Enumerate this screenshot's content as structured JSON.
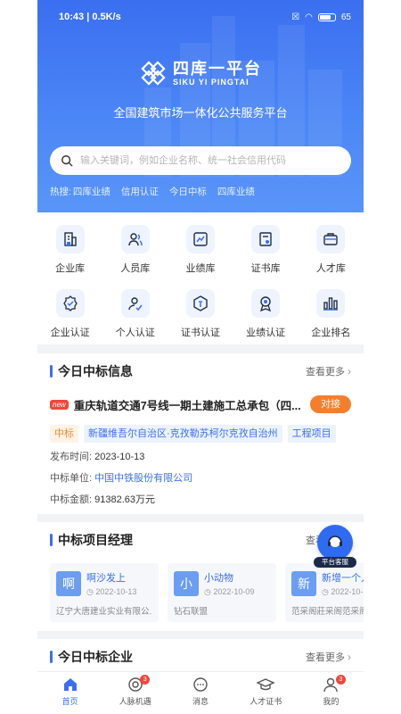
{
  "status": {
    "time_speed": "10:43 | 0.5K/s",
    "battery": "65"
  },
  "brand": {
    "name_cn": "四库一平台",
    "name_en": "SIKU YI PINGTAI",
    "slogan": "全国建筑市场一体化公共服务平台"
  },
  "search": {
    "placeholder": "输入关键词，例如企业名称、统一社会信用代码",
    "hot_label": "热搜:",
    "hot_items": [
      "四库业绩",
      "信用认证",
      "今日中标",
      "四库业绩"
    ]
  },
  "grid": [
    {
      "label": "企业库",
      "icon": "building-icon"
    },
    {
      "label": "人员库",
      "icon": "people-icon"
    },
    {
      "label": "业绩库",
      "icon": "chart-icon"
    },
    {
      "label": "证书库",
      "icon": "certificate-icon"
    },
    {
      "label": "人才库",
      "icon": "briefcase-icon"
    },
    {
      "label": "企业认证",
      "icon": "badge-check-icon"
    },
    {
      "label": "个人认证",
      "icon": "user-check-icon"
    },
    {
      "label": "证书认证",
      "icon": "box-icon"
    },
    {
      "label": "业绩认证",
      "icon": "medal-icon"
    },
    {
      "label": "企业排名",
      "icon": "bars-icon"
    }
  ],
  "bids": {
    "title": "今日中标信息",
    "more": "查看更多",
    "new_tag": "new",
    "item_title": "重庆轨道交通7号线一期土建施工总承包（四...",
    "dock_label": "对接",
    "tags": [
      "中标",
      "新疆维吾尔自治区·克孜勒苏柯尔克孜自治州",
      "工程项目"
    ],
    "publish_label": "发布时间:",
    "publish_date": "2023-10-13",
    "unit_label": "中标单位:",
    "unit_value": "中国中铁股份有限公司",
    "amount_label": "中标金额:",
    "amount_value": "91382.63万元"
  },
  "managers": {
    "title": "中标项目经理",
    "more": "查看更多",
    "items": [
      {
        "avatar": "啊",
        "name": "啊沙发上",
        "date": "2022-10-13",
        "company": "辽宁大唐建业实业有限公...",
        "color": "#6b9df2"
      },
      {
        "avatar": "小",
        "name": "小动物",
        "date": "2022-10-09",
        "company": "钻石联盟",
        "color": "#6b9df2"
      },
      {
        "avatar": "新",
        "name": "新增一个人",
        "date": "2022-10-",
        "company": "范采阁莊采阁范采阁",
        "color": "#6b9df2"
      }
    ]
  },
  "float_service": "平台客服",
  "companies": {
    "title": "今日中标企业",
    "more": "查看更多"
  },
  "tabbar": [
    {
      "label": "首页",
      "icon": "home-icon",
      "active": true,
      "badge": ""
    },
    {
      "label": "人脉机遇",
      "icon": "network-icon",
      "active": false,
      "badge": "3"
    },
    {
      "label": "消息",
      "icon": "message-icon",
      "active": false,
      "badge": ""
    },
    {
      "label": "人才证书",
      "icon": "graduation-icon",
      "active": false,
      "badge": ""
    },
    {
      "label": "我的",
      "icon": "user-icon",
      "active": false,
      "badge": "3"
    }
  ]
}
